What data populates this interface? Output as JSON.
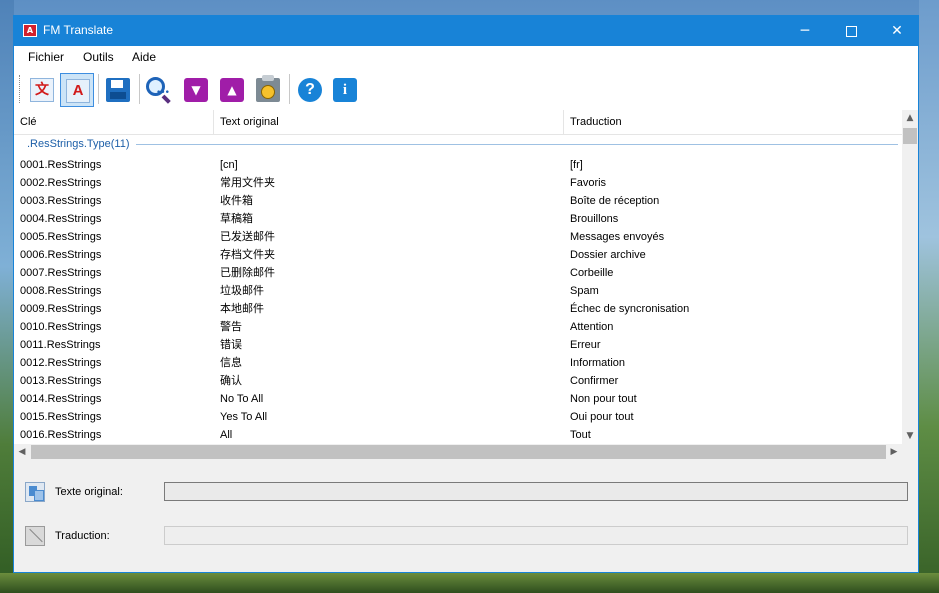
{
  "window": {
    "title": "FM Translate",
    "app_icon_text": "A"
  },
  "menu": {
    "items": [
      "Fichier",
      "Outils",
      "Aide"
    ]
  },
  "toolbar": {
    "icons": [
      "translate-doc-icon",
      "text-a-icon",
      "save-icon",
      "search-icon",
      "chevron-down-icon",
      "chevron-up-icon",
      "clipboard-clock-icon",
      "help-icon",
      "info-icon"
    ],
    "doc_glyph": "文",
    "a_glyph": "A",
    "help_glyph": "?",
    "info_glyph": "i"
  },
  "table": {
    "columns": [
      "Clé",
      "Text original",
      "Traduction"
    ],
    "group_label": ".ResStrings.Type(11)",
    "rows": [
      {
        "key": "0001.ResStrings",
        "orig": "[cn]",
        "trans": "[fr]"
      },
      {
        "key": "0002.ResStrings",
        "orig": "常用文件夹",
        "trans": "Favoris"
      },
      {
        "key": "0003.ResStrings",
        "orig": "收件箱",
        "trans": "Boîte de réception"
      },
      {
        "key": "0004.ResStrings",
        "orig": "草稿箱",
        "trans": "Brouillons"
      },
      {
        "key": "0005.ResStrings",
        "orig": "已发送邮件",
        "trans": "Messages envoyés"
      },
      {
        "key": "0006.ResStrings",
        "orig": "存档文件夹",
        "trans": "Dossier archive"
      },
      {
        "key": "0007.ResStrings",
        "orig": "已删除邮件",
        "trans": "Corbeille"
      },
      {
        "key": "0008.ResStrings",
        "orig": "垃圾邮件",
        "trans": "Spam"
      },
      {
        "key": "0009.ResStrings",
        "orig": "本地邮件",
        "trans": "Échec de syncronisation"
      },
      {
        "key": "0010.ResStrings",
        "orig": "警告",
        "trans": "Attention"
      },
      {
        "key": "0011.ResStrings",
        "orig": "错误",
        "trans": "Erreur"
      },
      {
        "key": "0012.ResStrings",
        "orig": "信息",
        "trans": "Information"
      },
      {
        "key": "0013.ResStrings",
        "orig": "确认",
        "trans": "Confirmer"
      },
      {
        "key": "0014.ResStrings",
        "orig": "No To All",
        "trans": "Non pour tout"
      },
      {
        "key": "0015.ResStrings",
        "orig": "Yes To All",
        "trans": "Oui pour tout"
      },
      {
        "key": "0016.ResStrings",
        "orig": "All",
        "trans": "Tout"
      }
    ]
  },
  "details": {
    "original_label": "Texte original:",
    "translation_label": "Traduction:",
    "original_value": "",
    "translation_value": ""
  }
}
